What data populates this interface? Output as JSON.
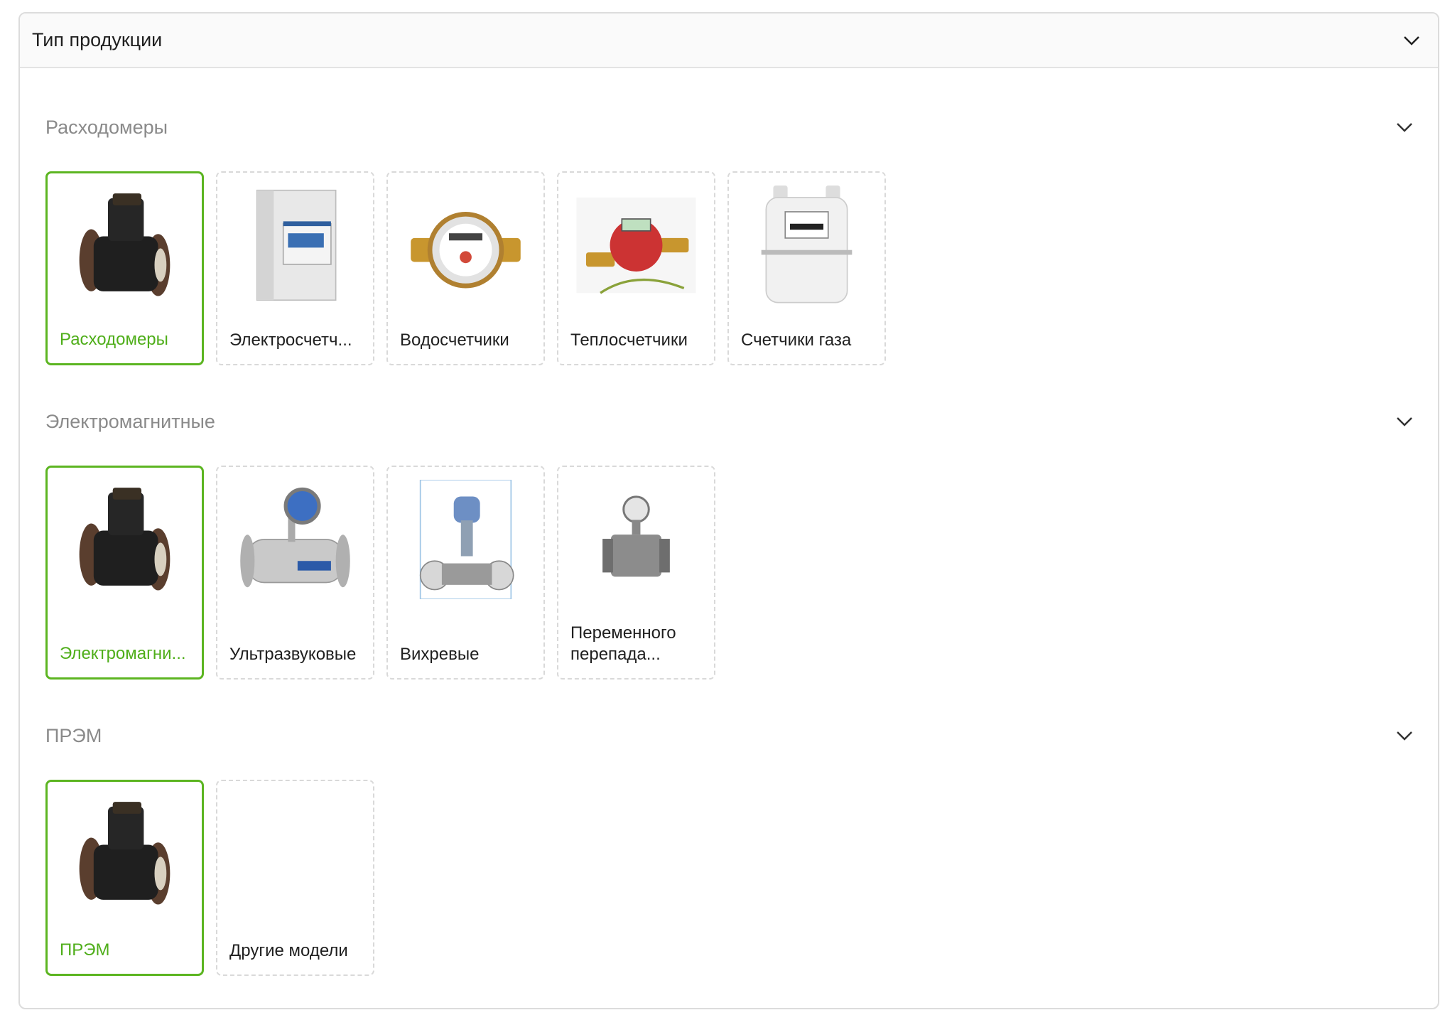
{
  "panel": {
    "title": "Тип продукции"
  },
  "accent_color": "#5cb521",
  "groups": [
    {
      "title": "Расходомеры",
      "cards": [
        {
          "label": "Расходомеры",
          "icon": "flowmeter-image",
          "active": true
        },
        {
          "label": "Электросчетч...",
          "icon": "electricity-meter-image",
          "active": false
        },
        {
          "label": "Водосчетчики",
          "icon": "water-meter-image",
          "active": false
        },
        {
          "label": "Теплосчетчики",
          "icon": "heat-meter-image",
          "active": false
        },
        {
          "label": "Счетчики газа",
          "icon": "gas-meter-image",
          "active": false
        }
      ]
    },
    {
      "title": "Электромагнитные",
      "cards": [
        {
          "label": "Электромагни...",
          "icon": "flowmeter-image",
          "active": true
        },
        {
          "label": "Ультразвуковые",
          "icon": "ultrasonic-meter-image",
          "active": false
        },
        {
          "label": "Вихревые",
          "icon": "vortex-meter-image",
          "active": false
        },
        {
          "label": "Переменного перепада...",
          "icon": "differential-pressure-meter-image",
          "active": false
        }
      ]
    },
    {
      "title": "ПРЭМ",
      "cards": [
        {
          "label": "ПРЭМ",
          "icon": "flowmeter-image",
          "active": true
        },
        {
          "label": "Другие модели",
          "icon": "",
          "active": false
        }
      ]
    }
  ]
}
